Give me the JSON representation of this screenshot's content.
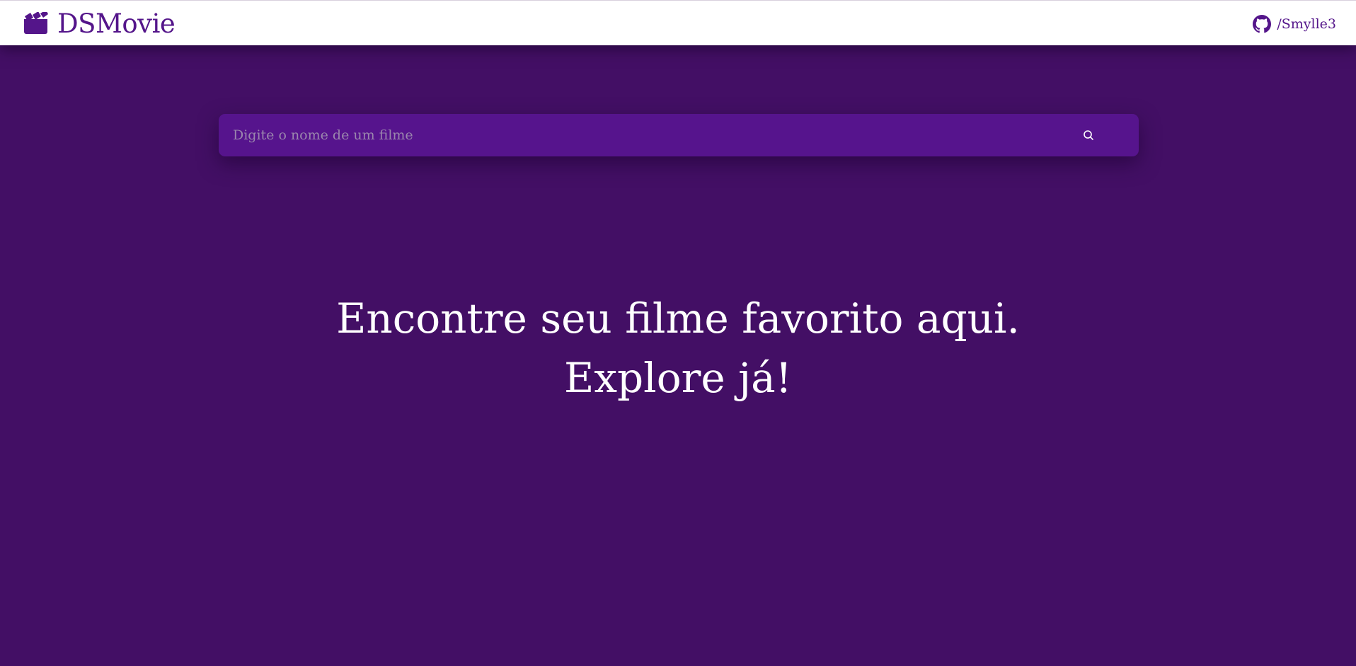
{
  "header": {
    "brand_name": "DSMovie",
    "brand_icon": "clapperboard-icon",
    "github_icon": "github-icon",
    "github_label": "/Smylle3"
  },
  "search": {
    "placeholder": "Digite o nome de um filme",
    "value": "",
    "icon": "search-icon"
  },
  "hero": {
    "line1": "Encontre seu filme favorito aqui.",
    "line2": "Explore já!"
  },
  "colors": {
    "background": "#430f65",
    "header_background": "#ffffff",
    "brand": "#54158a",
    "search_background": "#56148d",
    "placeholder": "#9a86ad",
    "hero_text": "#ffffff"
  }
}
